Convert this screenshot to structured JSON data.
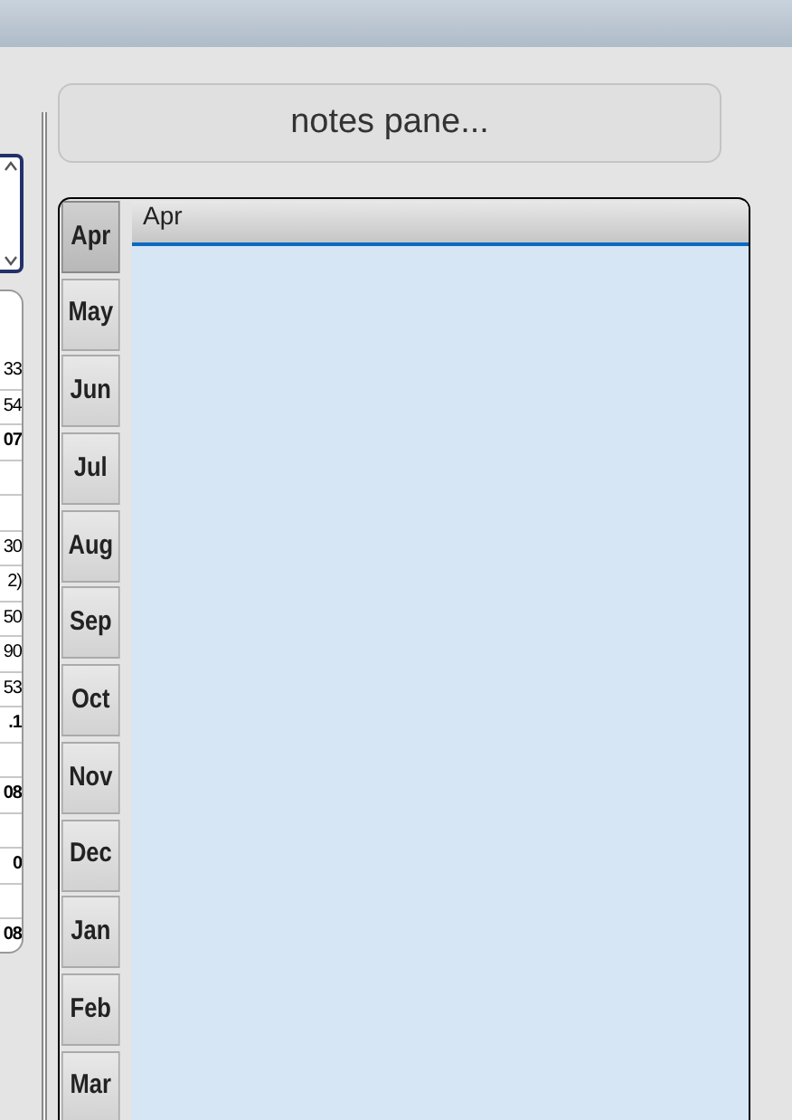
{
  "notes_button": {
    "label": "notes pane..."
  },
  "left_table": {
    "rows": [
      {
        "kind": "value",
        "text": "33",
        "bold": false
      },
      {
        "kind": "value",
        "text": "54",
        "bold": false
      },
      {
        "kind": "value",
        "text": "07",
        "bold": true
      },
      {
        "kind": "blank"
      },
      {
        "kind": "blank"
      },
      {
        "kind": "value",
        "text": "30",
        "bold": false
      },
      {
        "kind": "value",
        "text": "2)",
        "bold": false
      },
      {
        "kind": "value",
        "text": "50",
        "bold": false
      },
      {
        "kind": "value",
        "text": "90",
        "bold": false
      },
      {
        "kind": "value",
        "text": "53",
        "bold": false
      },
      {
        "kind": "value",
        "text": ".1",
        "bold": true
      },
      {
        "kind": "blank"
      },
      {
        "kind": "value",
        "text": "08",
        "bold": true
      },
      {
        "kind": "blank"
      },
      {
        "kind": "value",
        "text": "0",
        "bold": true
      },
      {
        "kind": "blank"
      },
      {
        "kind": "value",
        "text": "08",
        "bold": true
      }
    ]
  },
  "month_tabs": [
    {
      "label": "Apr",
      "selected": true
    },
    {
      "label": "May",
      "selected": false
    },
    {
      "label": "Jun",
      "selected": false
    },
    {
      "label": "Jul",
      "selected": false
    },
    {
      "label": "Aug",
      "selected": false
    },
    {
      "label": "Sep",
      "selected": false
    },
    {
      "label": "Oct",
      "selected": false
    },
    {
      "label": "Nov",
      "selected": false
    },
    {
      "label": "Dec",
      "selected": false
    },
    {
      "label": "Jan",
      "selected": false
    },
    {
      "label": "Feb",
      "selected": false
    },
    {
      "label": "Mar",
      "selected": false
    }
  ],
  "tab_content": {
    "header": "Apr"
  }
}
